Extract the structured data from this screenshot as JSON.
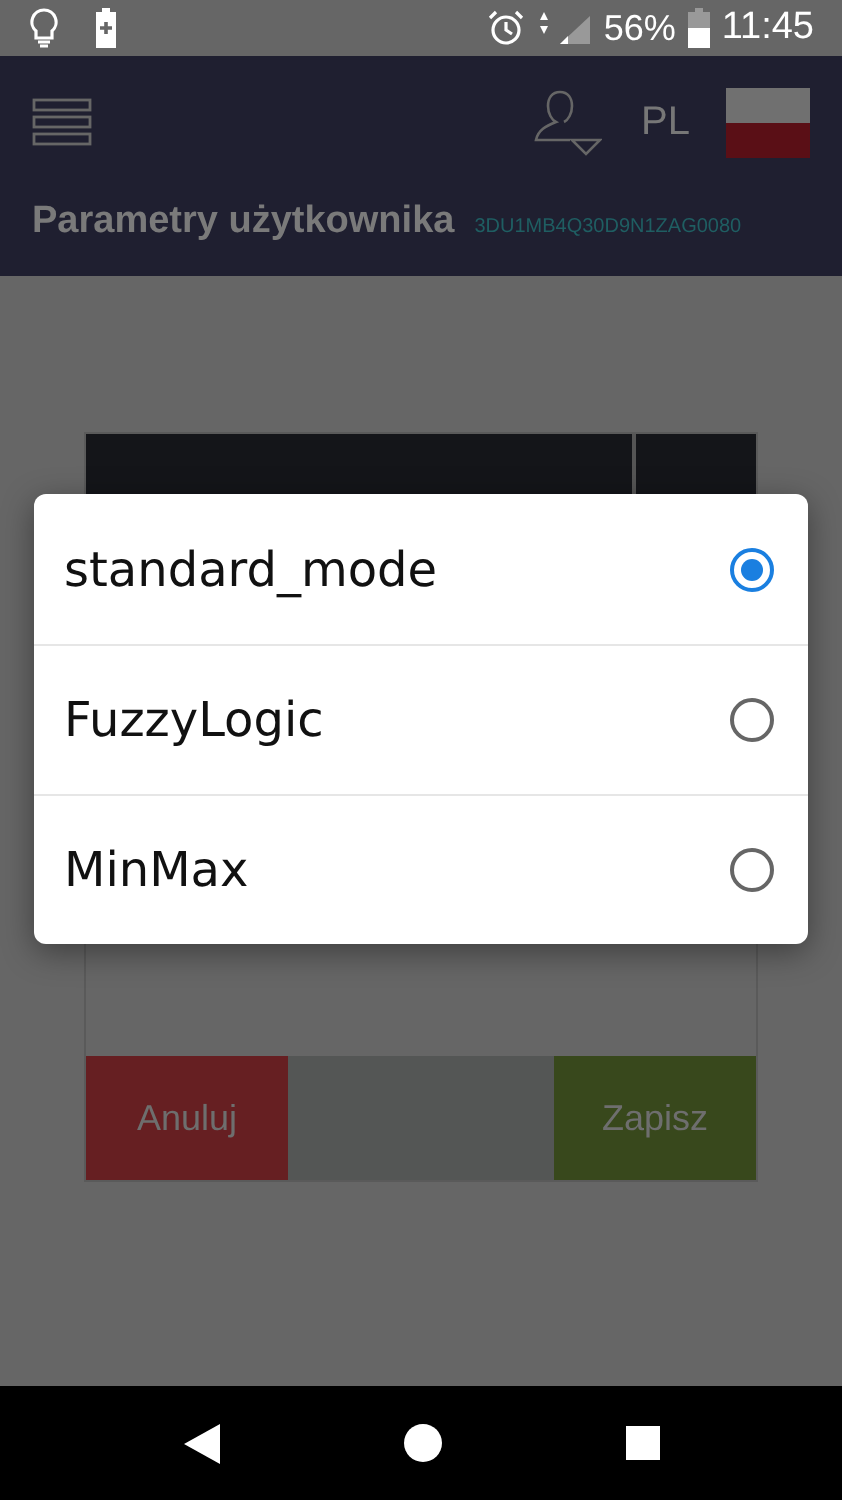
{
  "status_bar": {
    "battery": "56%",
    "time": "11:45"
  },
  "app_bar": {
    "language": "PL",
    "title": "Parametry użytkownika",
    "device_id": "3DU1MB4Q30D9N1ZAG0080"
  },
  "form": {
    "buttons": [
      {
        "label": "Anuluj",
        "kind": "cancel"
      },
      {
        "label": "Zapisz",
        "kind": "save"
      }
    ]
  },
  "dialog": {
    "options": [
      {
        "label": "standard_mode",
        "selected": true
      },
      {
        "label": "FuzzyLogic",
        "selected": false
      },
      {
        "label": "MinMax",
        "selected": false
      }
    ]
  }
}
